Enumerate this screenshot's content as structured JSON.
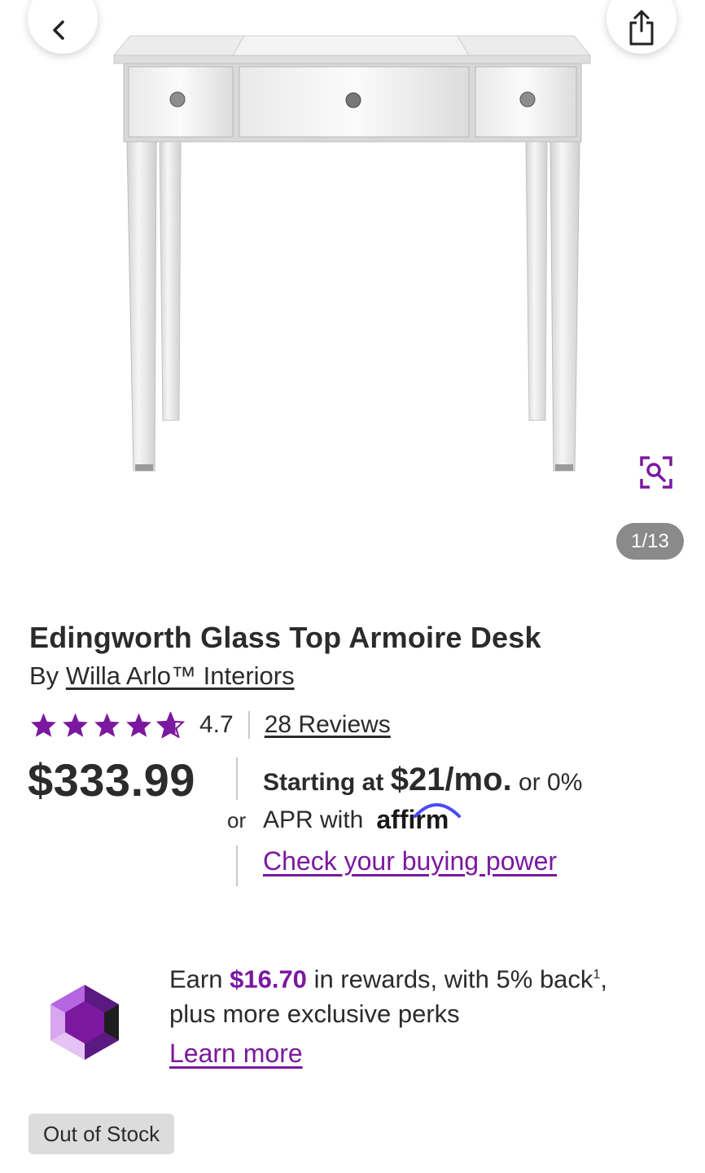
{
  "product": {
    "title": "Edingworth Glass Top Armoire Desk",
    "by_prefix": "By",
    "brand": "Willa Arlo™ Interiors",
    "rating": "4.7",
    "star_count": 5,
    "reviews_link": "28 Reviews",
    "price": "$333.99"
  },
  "gallery": {
    "counter": "1/13"
  },
  "financing": {
    "or_label": "or",
    "starting_prefix": "Starting at",
    "monthly": "$21/mo.",
    "suffix": "or 0%",
    "apr_text": "APR with",
    "affirm_logo": "affirm",
    "buying_power_link": "Check your buying power"
  },
  "rewards": {
    "earn_prefix": "Earn",
    "amount": "$16.70",
    "earn_mid": "in rewards, with 5% back",
    "footnote": "1",
    "earn_suffix": ",",
    "line2": "plus more exclusive perks",
    "learn_more": "Learn more"
  },
  "stock": {
    "badge": "Out of Stock"
  },
  "icons": {
    "back": "chevron-left-icon",
    "share": "share-icon",
    "zoom": "zoom-search-icon",
    "star": "star-icon",
    "gem": "gem-icon"
  },
  "colors": {
    "accent": "#7b189f",
    "star": "#7b189f",
    "badge_bg": "#dcdcdc",
    "counter_bg": "#8a8a8a",
    "text": "#2b2b2b"
  }
}
